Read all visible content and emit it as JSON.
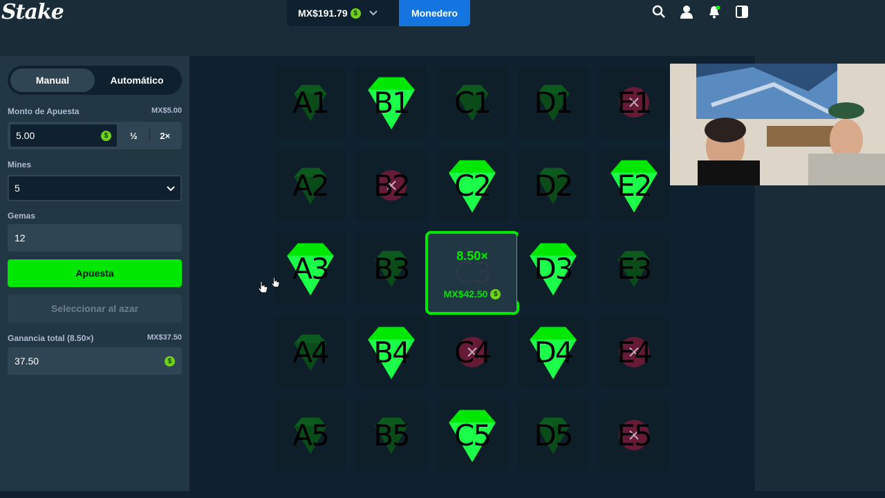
{
  "header": {
    "logo": "Stake",
    "balance": "MX$191.79",
    "coin_symbol": "$",
    "wallet_label": "Monedero",
    "icons": [
      "search-icon",
      "user-icon",
      "notification-icon",
      "sidebar-toggle-icon"
    ]
  },
  "sidebar": {
    "tabs": [
      "Manual",
      "Automático"
    ],
    "bet_amount_label": "Monto de Apuesta",
    "bet_amount_limit": "MX$5.00",
    "bet_amount_value": "5.00",
    "half_label": "½",
    "double_label": "2×",
    "mines_label": "Mines",
    "mines_value": "5",
    "gems_label": "Gemas",
    "gems_value": "12",
    "bet_button": "Apuesta",
    "random_button": "Seleccionar al azar",
    "profit_label": "Ganancia total (8.50×)",
    "profit_amount": "MX$37.50",
    "profit_value": "37.50"
  },
  "grid": {
    "tiles": [
      {
        "code": "A1",
        "type": "gem-dim"
      },
      {
        "code": "B1",
        "type": "gem"
      },
      {
        "code": "C1",
        "type": "gem-dim"
      },
      {
        "code": "D1",
        "type": "gem-dim"
      },
      {
        "code": "E1",
        "type": "mine-dim"
      },
      {
        "code": "A2",
        "type": "gem-dim"
      },
      {
        "code": "B2",
        "type": "mine-dim"
      },
      {
        "code": "C2",
        "type": "gem"
      },
      {
        "code": "D2",
        "type": "gem-dim"
      },
      {
        "code": "E2",
        "type": "gem"
      },
      {
        "code": "A3",
        "type": "gem"
      },
      {
        "code": "B3",
        "type": "gem-dim"
      },
      {
        "code": "C3",
        "type": "winner"
      },
      {
        "code": "D3",
        "type": "gem"
      },
      {
        "code": "E3",
        "type": "gem-dim"
      },
      {
        "code": "A4",
        "type": "gem-dim"
      },
      {
        "code": "B4",
        "type": "gem"
      },
      {
        "code": "C4",
        "type": "mine-dim"
      },
      {
        "code": "D4",
        "type": "gem"
      },
      {
        "code": "E4",
        "type": "mine-dim"
      },
      {
        "code": "A5",
        "type": "gem-dim"
      },
      {
        "code": "B5",
        "type": "gem-dim"
      },
      {
        "code": "C5",
        "type": "gem"
      },
      {
        "code": "D5",
        "type": "gem-dim"
      },
      {
        "code": "E5",
        "type": "mine-dim"
      }
    ],
    "winner_multiplier": "8.50×",
    "winner_amount": "MX$42.50"
  },
  "colors": {
    "accent_green": "#00e701",
    "wallet_blue": "#1475e1",
    "mine_red": "#8a1a3a"
  }
}
